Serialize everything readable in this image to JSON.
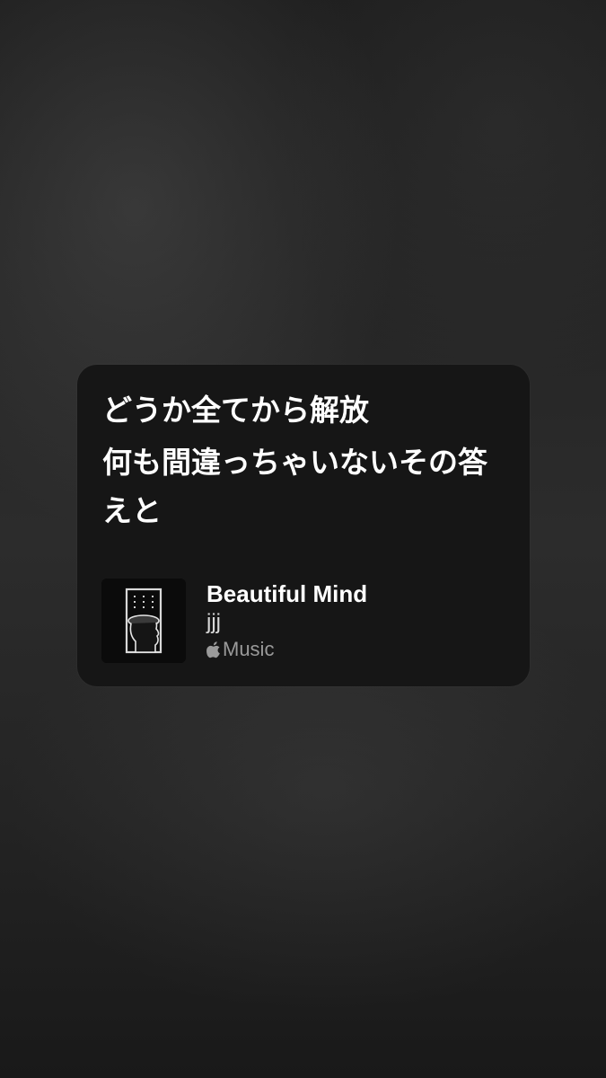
{
  "card": {
    "lyrics": [
      "どうか全てから解放",
      "何も間違っちゃいないその答えと"
    ],
    "song": {
      "title": "Beautiful Mind",
      "artist": "jjj",
      "service": "Music",
      "service_icon": "apple-logo-icon"
    }
  },
  "colors": {
    "card_background": "#161616",
    "lyrics_text": "#ffffff",
    "service_text": "#9a9a9a"
  }
}
